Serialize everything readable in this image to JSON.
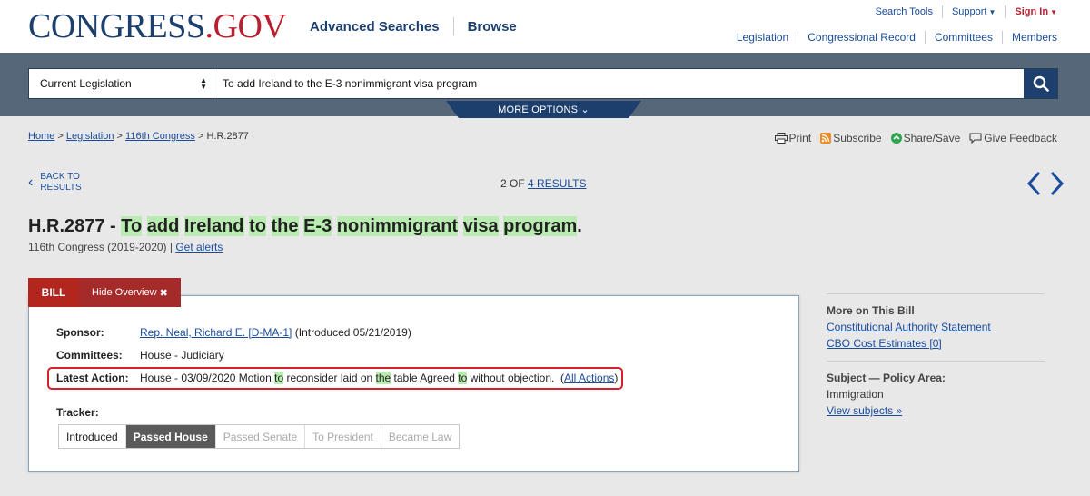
{
  "header": {
    "logo_main": "CONGRESS",
    "logo_gov": ".GOV",
    "nav": [
      "Advanced Searches",
      "Browse"
    ],
    "utility": {
      "search_tools": "Search Tools",
      "support": "Support",
      "sign_in": "Sign In"
    },
    "secondary_nav": [
      "Legislation",
      "Congressional Record",
      "Committees",
      "Members"
    ]
  },
  "search": {
    "scope": "Current Legislation",
    "query": "To add Ireland to the E-3 nonimmigrant visa program",
    "more_options": "MORE OPTIONS"
  },
  "breadcrumb": {
    "home": "Home",
    "legislation": "Legislation",
    "congress": "116th Congress",
    "current": "H.R.2877"
  },
  "tools": {
    "print": "Print",
    "subscribe": "Subscribe",
    "share": "Share/Save",
    "feedback": "Give Feedback"
  },
  "results_nav": {
    "back_line1": "BACK TO",
    "back_line2": "RESULTS",
    "position": "2 OF ",
    "total": "4 RESULTS"
  },
  "bill": {
    "number": "H.R.2877",
    "title_words": [
      "To",
      "add",
      "Ireland",
      "to",
      "the",
      "E-3",
      "nonimmigrant",
      "visa",
      "program"
    ],
    "congress": "116th Congress (2019-2020)",
    "get_alerts": "Get alerts"
  },
  "tabs": {
    "bill": "BILL",
    "hide_overview": "Hide Overview"
  },
  "overview": {
    "sponsor_label": "Sponsor:",
    "sponsor_link": "Rep. Neal, Richard E. [D-MA-1]",
    "sponsor_intro": "(Introduced 05/21/2019)",
    "committees_label": "Committees:",
    "committees": "House - Judiciary",
    "latest_label": "Latest Action:",
    "latest_p1": "House - 03/09/2020 Motion ",
    "latest_w1": "to",
    "latest_p2": " reconsider laid on ",
    "latest_w2": "the",
    "latest_p3": " table Agreed ",
    "latest_w3": "to",
    "latest_p4": " without objection.  (",
    "all_actions": "All Actions",
    "latest_p5": ")",
    "tracker_label": "Tracker:",
    "tracker_steps": [
      "Introduced",
      "Passed House",
      "Passed Senate",
      "To President",
      "Became Law"
    ]
  },
  "sidebar": {
    "more_head": "More on This Bill",
    "links": [
      "Constitutional Authority Statement",
      "CBO Cost Estimates [0]"
    ],
    "subject_head": "Subject — Policy Area:",
    "subject": "Immigration",
    "view_subjects": "View subjects »"
  },
  "colors": {
    "brand_blue": "#1d3f6e",
    "brand_red": "#b81f2f",
    "highlight": "#b9ecb0",
    "action_border": "#d61f26"
  }
}
